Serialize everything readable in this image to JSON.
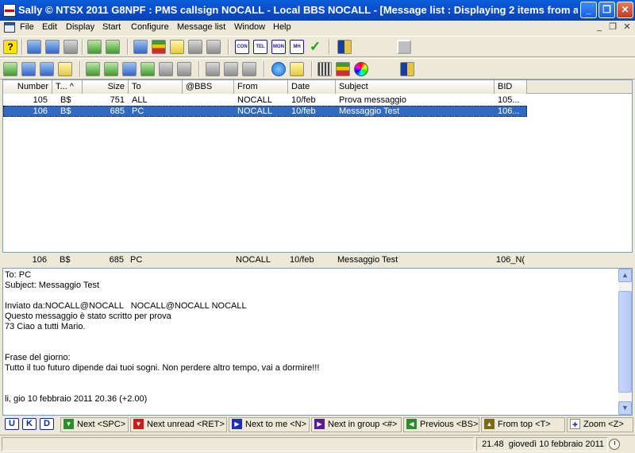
{
  "window": {
    "title": "Sally © NTSX 2011 G8NPF : PMS callsign NOCALL - Local BBS NOCALL - [Message list : Displaying 2 items from a ...",
    "minimize": "_",
    "maximize": "❐",
    "close": "✕"
  },
  "menu": {
    "items": [
      "File",
      "Edit",
      "Display",
      "Start",
      "Configure",
      "Message list",
      "Window",
      "Help"
    ],
    "mdi_minimize": "_",
    "mdi_restore": "❐",
    "mdi_close": "✕"
  },
  "toolbar1": {
    "help_glyph": "?",
    "con_label": "CON",
    "tel_label": "TEL",
    "mon_label": "MON",
    "mh_label": "MH",
    "check_glyph": "✓"
  },
  "list": {
    "columns": [
      "Number",
      "T... ^",
      "Size",
      "To",
      "@BBS",
      "From",
      "Date",
      "Subject",
      "BID"
    ],
    "rows": [
      {
        "number": "105",
        "type": "B$",
        "size": "751",
        "to": "ALL",
        "bbs": "",
        "from": "NOCALL",
        "date": "10/feb",
        "subject": "Prova messaggio",
        "bid": "105..."
      },
      {
        "number": "106",
        "type": "B$",
        "size": "685",
        "to": "PC",
        "bbs": "",
        "from": "NOCALL",
        "date": "10/feb",
        "subject": "Messaggio Test",
        "bid": "106..."
      }
    ],
    "selected_index": 1
  },
  "preview_header": {
    "number": "106",
    "type": "B$",
    "size": "685",
    "to": "PC",
    "from": "NOCALL",
    "date": "10/feb",
    "subject": "Messaggio Test",
    "bid": "106_N("
  },
  "message_body": "To: PC\nSubject: Messaggio Test\n\nInviato da:NOCALL@NOCALL   NOCALL@NOCALL NOCALL\nQuesto messaggio è stato scritto per prova\n73 Ciao a tutti Mario.\n\n\nFrase del giorno:\nTutto il tuo futuro dipende dai tuoi sogni. Non perdere altro tempo, vai a dormire!!!\n\n\nli, gio 10 febbraio 2011 20.36 (+2.00)",
  "nav": {
    "u": "U",
    "k": "K",
    "d": "D",
    "next": "Next <SPC>",
    "next_unread": "Next unread <RET>",
    "next_to_me": "Next to me <N>",
    "next_in_group": "Next in group <#>",
    "previous": "Previous <BS>",
    "from_top": "From top <T>",
    "zoom": "Zoom <Z>"
  },
  "status": {
    "time": "21.48",
    "date": "giovedì 10 febbraio 2011"
  },
  "colors": {
    "selection": "#316AC5",
    "title_bar": "#0A5FDB",
    "nav_green": "#2E8B2E",
    "nav_red": "#C81E1E",
    "nav_blue": "#1E2FB4",
    "nav_purple": "#5A1E8C",
    "nav_olive": "#7A6A1A"
  }
}
